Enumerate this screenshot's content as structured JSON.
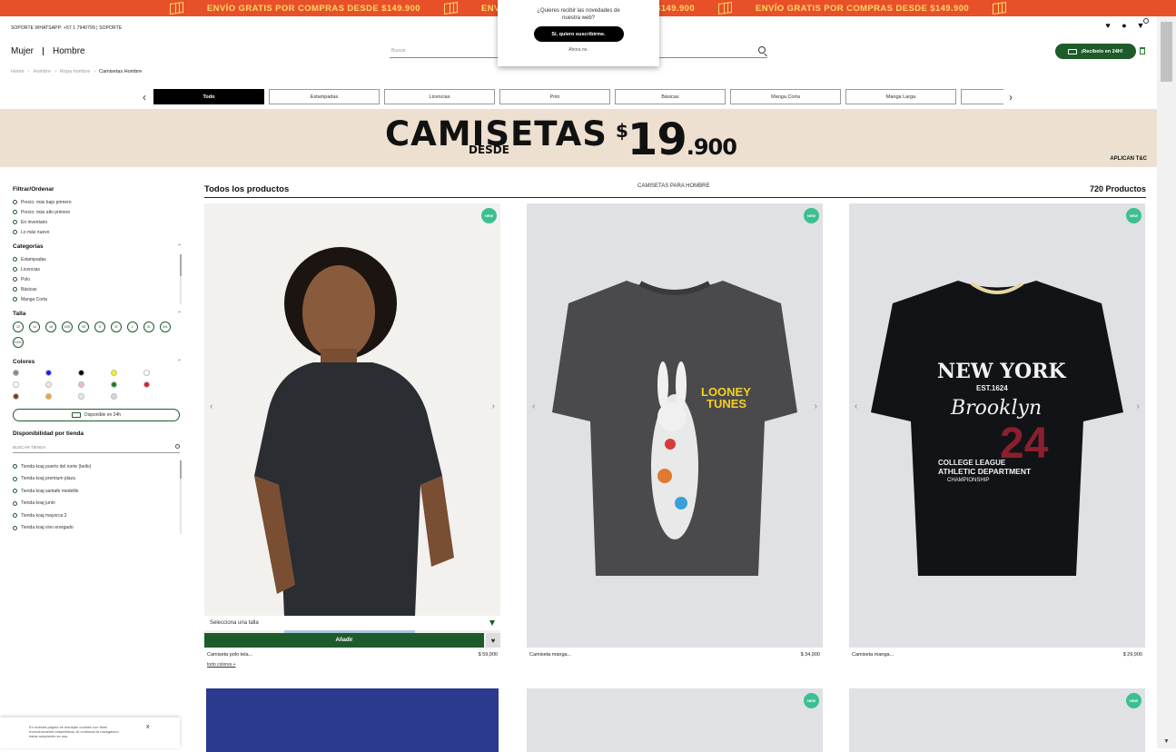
{
  "promo": {
    "text": "ENVÍO GRATIS POR COMPRAS DESDE $149.900"
  },
  "topbar": {
    "support": "SOPORTE WHATSAPP: +57 1 7940799  |  SOPORTE"
  },
  "nav": {
    "women": "Mujer",
    "men": "Hombre"
  },
  "search": {
    "placeholder": "Buscar"
  },
  "recibelo": {
    "label": "¡Recíbelo en 24H!"
  },
  "breadcrumb": [
    "Home",
    "Hombre",
    "Ropa hombre",
    "Camisetas Hombre"
  ],
  "categories": [
    "Todo",
    "Estampadas",
    "Licencias",
    "Polo",
    "Básicas",
    "Manga Corta",
    "Manga Larga",
    ""
  ],
  "banner": {
    "title": "CAMISETAS",
    "subtitle": "DESDE",
    "currency": "$",
    "price": "19",
    "price_dec": ".900",
    "tc": "APLICAN T&C"
  },
  "sidebar": {
    "filter_title": "Filtrar/Ordenar",
    "sort_options": [
      "Precio: más bajo primero",
      "Precio: más alto primero",
      "En inventario",
      "Lo más nuevo"
    ],
    "categories_title": "Categorías",
    "category_options": [
      "Estampadas",
      "Licencias",
      "Polo",
      "Básicas",
      "Manga Corta"
    ],
    "size_title": "Talla",
    "sizes": [
      "12",
      "14",
      "16",
      "XXS",
      "XS",
      "S",
      "M",
      "L",
      "XL",
      "XXL",
      "XXXL"
    ],
    "colors_title": "Colores",
    "colors": [
      "#888888",
      "#1a1aff",
      "#000000",
      "#f5f500",
      "#ffffff",
      "#ffffff",
      "#f3ead8",
      "#f4b6c2",
      "#1e7d1e",
      "#d42020",
      "#7a3b1a",
      "#f5a623",
      "#e8e8e8",
      "#d8d8d8"
    ],
    "disp24": "Disponible en 24h",
    "store_title": "Disponibilidad por tienda",
    "store_search": "BUSCAR TIENDA",
    "stores": [
      "Tienda koaj puerto del norte (bello)",
      "Tienda koaj premium plaza",
      "Tienda koaj santafe medellin",
      "Tienda koaj junin",
      "Tienda koaj mayorca 2",
      "Tienda koaj vivo envigado"
    ]
  },
  "results": {
    "title": "Todos los productos",
    "subtitle": "CAMISETAS PARA HOMBRE",
    "count": "720 Productos"
  },
  "products": [
    {
      "badge": "NEW",
      "name": "Camiseta polo tela...",
      "price": "$ 59,900",
      "size_select": "Selecciona una talla",
      "add": "Añadir",
      "colors_link": "todo colores +"
    },
    {
      "badge": "NEW",
      "name": "Camiseta manga...",
      "price": "$ 34,900",
      "print1": "LOONEY",
      "print2": "TUNES"
    },
    {
      "badge": "NEW",
      "name": "Camiseta manga...",
      "price": "$ 29,900",
      "print1": "NEW YORK",
      "print2": "EST.1624",
      "print3": "Brooklyn",
      "print4": "24",
      "print5": "COLLEGE LEAGUE",
      "print6": "ATHLETIC DEPARTMENT",
      "print7": "CHAMPIONSHIP"
    }
  ],
  "row2_badges": [
    "NEW",
    "NEW"
  ],
  "popup": {
    "question": "¿Quieres recibir las novedades de nuestra web?",
    "yes": "Sí, quiero suscribirme.",
    "no": "Ahora no."
  },
  "cookie": {
    "text": "En nuestra página se manejan cookies con fines exclusivamente estadísticos. Al continuar la navegación estas aceptando su uso.",
    "close": "x"
  }
}
